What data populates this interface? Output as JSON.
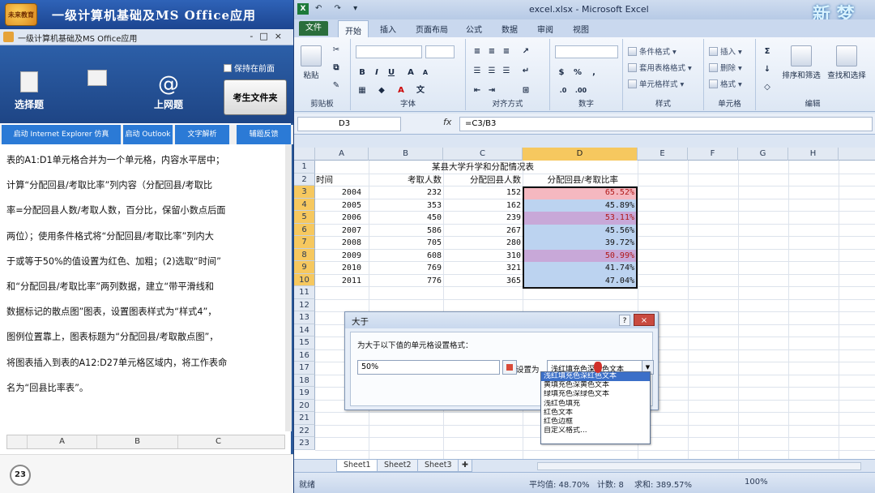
{
  "left_panel": {
    "app_title": "一级计算机基础及MS Office应用",
    "logo_text": "未来教育",
    "window_title": "一级计算机基础及MS Office应用",
    "window_buttons": "-□×",
    "toolbar": {
      "select_label": "选择题",
      "internet_label": "上网题",
      "keep_front_label": "保持在前面",
      "exam_folder_label": "考生文件夹"
    },
    "tabs": [
      "启动 Internet Explorer 仿真",
      "启动 Outlook",
      "文字解析",
      "辅题反馈"
    ],
    "question_lines": [
      "表的A1:D1单元格合并为一个单元格，内容水平居中；",
      "计算“分配回县/考取比率”列内容（分配回县/考取比",
      "率=分配回县人数/考取人数，百分比，保留小数点后面",
      "两位）；使用条件格式将“分配回县/考取比率”列内大",
      "于或等于50%的值设置为红色、加粗；(2)选取“时间”",
      "和“分配回县/考取比率”两列数据，建立“带平滑线和",
      "数据标记的散点图”图表，设置图表样式为“样式4”，",
      "图例位置靠上，图表标题为“分配回县/考取散点图”，",
      "将图表插入到表的A12:D27单元格区域内，将工作表命",
      "名为“回县比率表”。"
    ],
    "mini_sheet_cols": [
      "A",
      "B",
      "C"
    ],
    "question_number": "23"
  },
  "excel": {
    "quick_tools": "↶ ↷ ▾",
    "window_title": "excel.xlsx - Microsoft Excel",
    "brand": "新 梦",
    "ribbon_tabs": [
      "文件",
      "开始",
      "插入",
      "页面布局",
      "公式",
      "数据",
      "审阅",
      "视图"
    ],
    "ribbon_groups": {
      "clipboard": {
        "label": "剪贴板",
        "paste": "粘贴"
      },
      "font": {
        "label": "字体"
      },
      "alignment": {
        "label": "对齐方式"
      },
      "number": {
        "label": "数字"
      },
      "styles": {
        "label": "样式",
        "items": [
          "条件格式 ▾",
          "套用表格格式 ▾",
          "单元格样式 ▾"
        ]
      },
      "cells": {
        "label": "单元格",
        "items": [
          "插入 ▾",
          "删除 ▾",
          "格式 ▾"
        ]
      },
      "editing": {
        "label": "编辑",
        "sort": "排序和筛选",
        "find": "查找和选择"
      }
    },
    "name_box": "D3",
    "fx": "fx",
    "formula": "=C3/B3",
    "columns": [
      "A",
      "B",
      "C",
      "D",
      "E",
      "F",
      "G",
      "H"
    ],
    "rows": [
      "1",
      "2",
      "3",
      "4",
      "5",
      "6",
      "7",
      "8",
      "9",
      "10",
      "11",
      "12",
      "13",
      "14",
      "15",
      "16",
      "17",
      "18",
      "19",
      "20",
      "21",
      "22",
      "23"
    ],
    "sheet": {
      "title": "某县大学升学和分配情况表",
      "headers": [
        "时间",
        "考取人数",
        "分配回县人数",
        "分配回县/考取比率"
      ],
      "data": [
        {
          "year": "2004",
          "exam": "232",
          "back": "152",
          "ratio": "65.52%",
          "hl": "red"
        },
        {
          "year": "2005",
          "exam": "353",
          "back": "162",
          "ratio": "45.89%",
          "hl": "blue"
        },
        {
          "year": "2006",
          "exam": "450",
          "back": "239",
          "ratio": "53.11%",
          "hl": "purple"
        },
        {
          "year": "2007",
          "exam": "586",
          "back": "267",
          "ratio": "45.56%",
          "hl": "blue"
        },
        {
          "year": "2008",
          "exam": "705",
          "back": "280",
          "ratio": "39.72%",
          "hl": "blue"
        },
        {
          "year": "2009",
          "exam": "608",
          "back": "310",
          "ratio": "50.99%",
          "hl": "purple"
        },
        {
          "year": "2010",
          "exam": "769",
          "back": "321",
          "ratio": "41.74%",
          "hl": "blue"
        },
        {
          "year": "2011",
          "exam": "776",
          "back": "365",
          "ratio": "47.04%",
          "hl": "blue"
        }
      ]
    },
    "sheet_tabs": [
      "Sheet1",
      "Sheet2",
      "Sheet3"
    ],
    "status": {
      "ready": "就绪",
      "average": "平均值: 48.70%",
      "count": "计数: 8",
      "sum": "求和: 389.57%",
      "zoom": "100%"
    },
    "highlight_colors": {
      "red": "#f5b8c0",
      "blue": "#bcd3f0",
      "purple": "#c8a8d8"
    }
  },
  "dialog": {
    "title": "大于",
    "help": "?",
    "close": "×",
    "description": "为大于以下值的单元格设置格式：",
    "value": "50%",
    "set_label": "设置为",
    "selected": "浅红填充色深红色文本",
    "options": [
      "浅红填充色深红色文本",
      "黄填充色深黄色文本",
      "绿填充色深绿色文本",
      "浅红色填充",
      "红色文本",
      "红色边框",
      "自定义格式..."
    ]
  }
}
